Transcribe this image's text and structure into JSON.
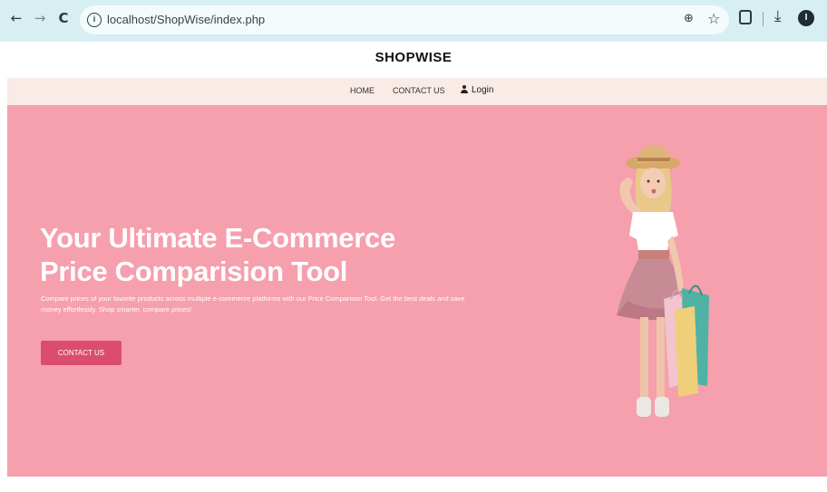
{
  "browser": {
    "back_glyph": "←",
    "forward_glyph": "→",
    "reload_glyph": "C",
    "url": "localhost/ShopWise/index.php",
    "site_info_glyph": "i",
    "zoom_glyph": "⊕",
    "star_glyph": "☆",
    "download_glyph": "⤓",
    "profile_initial": "I"
  },
  "site": {
    "brand": "SHOPWISE",
    "menu": {
      "home": "HOME",
      "contact": "CONTACT US",
      "login": "Login"
    }
  },
  "hero": {
    "title_line1": "Your Ultimate E-Commerce",
    "title_line2": "Price Comparision Tool",
    "description": "Compare prices of your favorite products across multiple e-commerce platforms with our Price Comparison Tool. Get the best deals and save money effortlessly. Shop smarter, compare prices!",
    "cta_label": "CONTACT US",
    "background_color": "#f69fad",
    "cta_color": "#dc4d6d"
  }
}
